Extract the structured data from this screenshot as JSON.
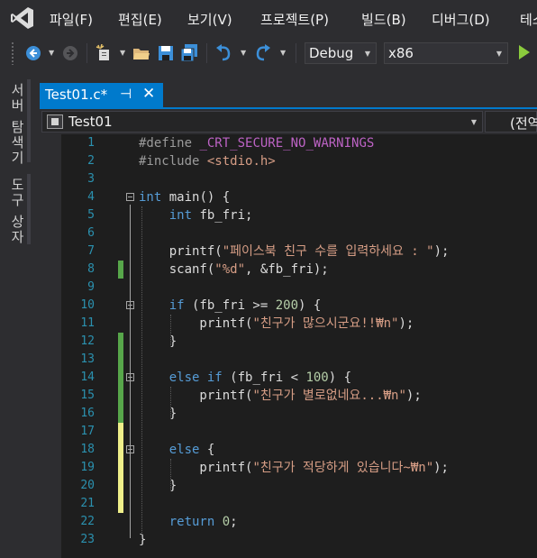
{
  "menu": [
    "파일(F)",
    "편집(E)",
    "보기(V)",
    "프로젝트(P)",
    "빌드(B)",
    "디버그(D)",
    "테스"
  ],
  "toolbar": {
    "config": "Debug",
    "platform": "x86",
    "icons": [
      "back-icon",
      "forward-icon",
      "new-project-icon",
      "open-folder-icon",
      "save-icon",
      "save-all-icon",
      "undo-icon",
      "redo-icon",
      "start-debug-icon"
    ]
  },
  "sidebar": {
    "server_explorer": "서버 탐색기",
    "toolbox": "도구 상자"
  },
  "document_tab": {
    "title": "Test01.c*",
    "pin": "⊣",
    "close": "✕"
  },
  "navbar": {
    "scope": "Test01",
    "member": "(전역"
  },
  "colors": {
    "accent": "#007acc",
    "changed_saved": "#57a64a",
    "changed_unsaved": "#efef8a",
    "keyword": "#569cd6",
    "string": "#d69d85",
    "line_number": "#2b91af"
  },
  "editor": {
    "lines": [
      {
        "num": "1",
        "html": "<span class=\"p\">#define</span> <span class=\"m\">_CRT_SECURE_NO_WARNINGS</span>",
        "change": "",
        "fold": false
      },
      {
        "num": "2",
        "html": "<span class=\"p\">#include</span> <span class=\"s\">&lt;stdio.h&gt;</span>",
        "change": "",
        "fold": false
      },
      {
        "num": "3",
        "html": "",
        "change": "",
        "fold": false
      },
      {
        "num": "4",
        "html": "<span class=\"k\">int</span> main() {",
        "change": "",
        "fold": true
      },
      {
        "num": "5",
        "html": "    <span class=\"k\">int</span> fb_fri;",
        "change": "",
        "fold": false
      },
      {
        "num": "6",
        "html": "",
        "change": "",
        "fold": false
      },
      {
        "num": "7",
        "html": "    printf(<span class=\"s\">\"페이스북 친구 수를 입력하세요 : \"</span>);",
        "change": "",
        "fold": false
      },
      {
        "num": "8",
        "html": "    scanf(<span class=\"s\">\"%d\"</span>, &amp;fb_fri);",
        "change": "saved",
        "fold": false
      },
      {
        "num": "9",
        "html": "",
        "change": "",
        "fold": false
      },
      {
        "num": "10",
        "html": "    <span class=\"k\">if</span> (fb_fri &gt;= <span class=\"n\">200</span>) {",
        "change": "",
        "fold": true
      },
      {
        "num": "11",
        "html": "        printf(<span class=\"s\">\"친구가 많으시군요!!₩n\"</span>);",
        "change": "",
        "fold": false
      },
      {
        "num": "12",
        "html": "    }",
        "change": "saved",
        "fold": false
      },
      {
        "num": "13",
        "html": "",
        "change": "saved",
        "fold": false
      },
      {
        "num": "14",
        "html": "    <span class=\"k\">else</span> <span class=\"k\">if</span> (fb_fri &lt; <span class=\"n\">100</span>) {",
        "change": "saved",
        "fold": true
      },
      {
        "num": "15",
        "html": "        printf(<span class=\"s\">\"친구가 별로없네요...₩n\"</span>);",
        "change": "saved",
        "fold": false
      },
      {
        "num": "16",
        "html": "    }",
        "change": "saved",
        "fold": false
      },
      {
        "num": "17",
        "html": "",
        "change": "unsaved",
        "fold": false
      },
      {
        "num": "18",
        "html": "    <span class=\"k\">else</span> {",
        "change": "unsaved",
        "fold": true
      },
      {
        "num": "19",
        "html": "        printf(<span class=\"s\">\"친구가 적당하게 있습니다~₩n\"</span>);",
        "change": "unsaved",
        "fold": false
      },
      {
        "num": "20",
        "html": "    }",
        "change": "unsaved",
        "fold": false
      },
      {
        "num": "21",
        "html": "",
        "change": "unsaved",
        "fold": false
      },
      {
        "num": "22",
        "html": "    <span class=\"k\">return</span> <span class=\"n\">0</span>;",
        "change": "",
        "fold": false
      },
      {
        "num": "23",
        "html": "}",
        "change": "",
        "fold": false
      }
    ]
  }
}
